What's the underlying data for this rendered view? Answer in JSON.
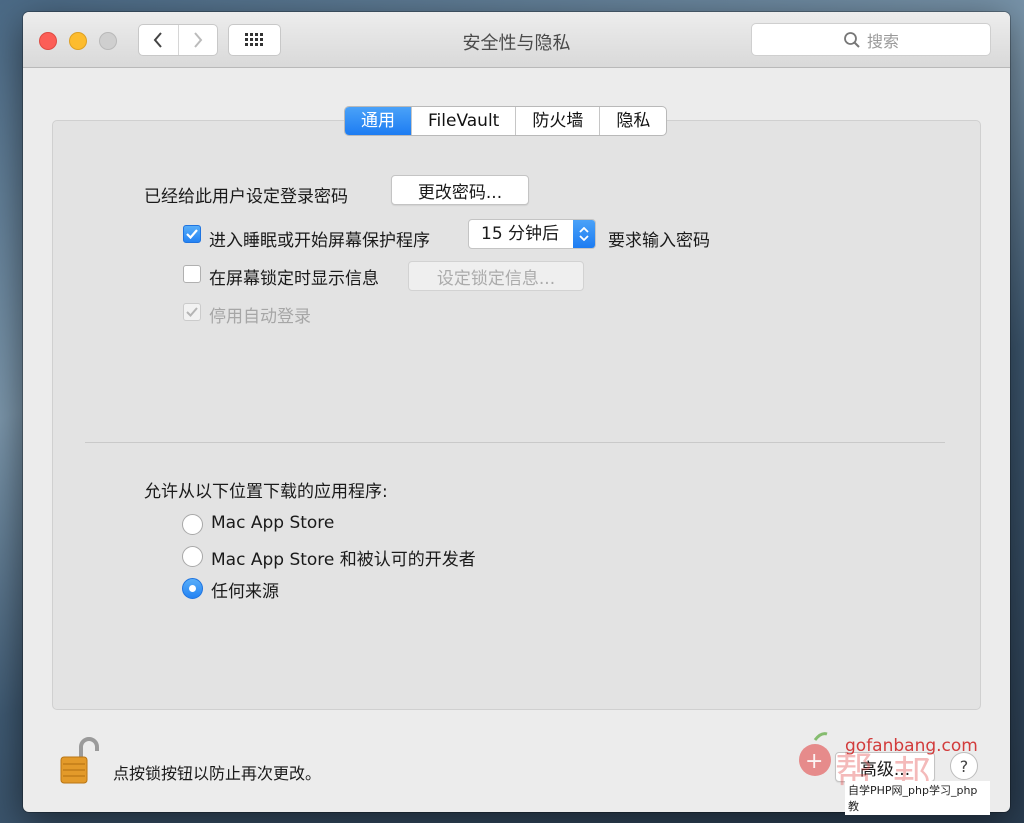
{
  "window": {
    "title": "安全性与隐私",
    "search_placeholder": "搜索"
  },
  "tabs": [
    {
      "label": "通用",
      "active": true
    },
    {
      "label": "FileVault",
      "active": false
    },
    {
      "label": "防火墙",
      "active": false
    },
    {
      "label": "隐私",
      "active": false
    }
  ],
  "general": {
    "password_set_label": "已经给此用户设定登录密码",
    "change_password_button": "更改密码...",
    "require_password": {
      "checked": true,
      "label": "进入睡眠或开始屏幕保护程序",
      "delay_value": "15 分钟后",
      "suffix": "要求输入密码"
    },
    "show_message": {
      "checked": false,
      "label": "在屏幕锁定时显示信息",
      "button": "设定锁定信息..."
    },
    "disable_auto_login": {
      "checked": true,
      "disabled": true,
      "label": "停用自动登录"
    }
  },
  "downloads": {
    "heading": "允许从以下位置下载的应用程序:",
    "options": [
      {
        "label": "Mac App Store",
        "selected": false
      },
      {
        "label": "Mac App Store 和被认可的开发者",
        "selected": false
      },
      {
        "label": "任何来源",
        "selected": true
      }
    ]
  },
  "footer": {
    "lock_text": "点按锁按钮以防止再次更改。",
    "advanced_button": "高级...",
    "help_button": "?"
  },
  "watermark": {
    "site": "gofanbang.com",
    "caption": "自学PHP网_php学习_php教"
  },
  "colors": {
    "accent": "#1d7cf2",
    "window_bg": "#ececec",
    "panel_bg": "#e3e3e3"
  }
}
